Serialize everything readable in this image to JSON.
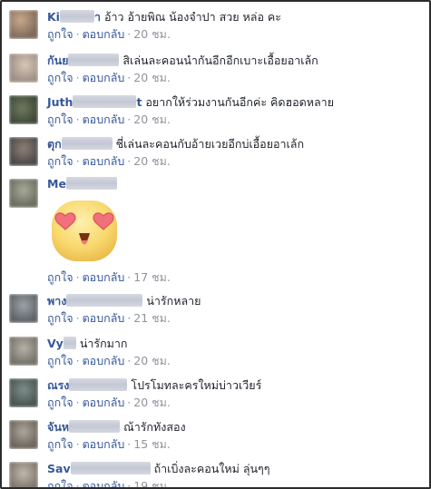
{
  "comments": [
    {
      "author_visible": "Ki",
      "author_tail": "า",
      "text": "อ้าว อ้ายพิณ น้องจำปา สวย หล่อ คะ",
      "like": "ถูกใจ",
      "reply": "ตอบกลับ",
      "time": "20 ชม."
    },
    {
      "author_visible": "กันย",
      "author_tail": "",
      "text": "สิเล่นละคอนนำกันอีกอีกเบาะเอื้อยอาเล้ก",
      "like": "ถูกใจ",
      "reply": "ตอบกลับ",
      "time": "20 ชม."
    },
    {
      "author_visible": "Juth",
      "author_tail": "t",
      "text": "อยากให้ร่วมงานกันอีกค่ะ คิดฮอดหลาย",
      "like": "ถูกใจ",
      "reply": "ตอบกลับ",
      "time": "20 ชม."
    },
    {
      "author_visible": "ตุก",
      "author_tail": "",
      "text": "ชี่เล่นละคอนกับอ้ายเวยอีกบ่เอื้อยอาเล้ก",
      "like": "ถูกใจ",
      "reply": "ตอบกลับ",
      "time": "20 ชม."
    },
    {
      "author_visible": "Me",
      "author_tail": "",
      "text": "",
      "like": "ถูกใจ",
      "reply": "ตอบกลับ",
      "time": "17 ชม."
    },
    {
      "author_visible": "พาง",
      "author_tail": "",
      "text": "น่ารักหลาย",
      "like": "ถูกใจ",
      "reply": "ตอบกลับ",
      "time": "21 ชม."
    },
    {
      "author_visible": "Vy",
      "author_tail": "",
      "text": "น่ารักมาก",
      "like": "ถูกใจ",
      "reply": "ตอบกลับ",
      "time": "20 ชม."
    },
    {
      "author_visible": "ณรง",
      "author_tail": "",
      "text": "โปรโมทละครใหม่บ่าวเวียร์",
      "like": "ถูกใจ",
      "reply": "ตอบกลับ",
      "time": "20 ชม."
    },
    {
      "author_visible": "จันห",
      "author_tail": "",
      "text": "ณ้ารักทังสอง",
      "like": "ถูกใจ",
      "reply": "ตอบกลับ",
      "time": "15 ชม."
    },
    {
      "author_visible": "Sav",
      "author_tail": "",
      "text": "ถ้าเบิ่งละคอนใหม่ ลุ่นๆๆ",
      "like": "ถูกใจ",
      "reply": "ตอบกลับ",
      "time": "19 ชม."
    }
  ],
  "sticker": {
    "icon": "heart-eyes-emoji-icon"
  },
  "colors": {
    "link": "#365899",
    "meta": "#90949c",
    "text": "#1d2129"
  }
}
